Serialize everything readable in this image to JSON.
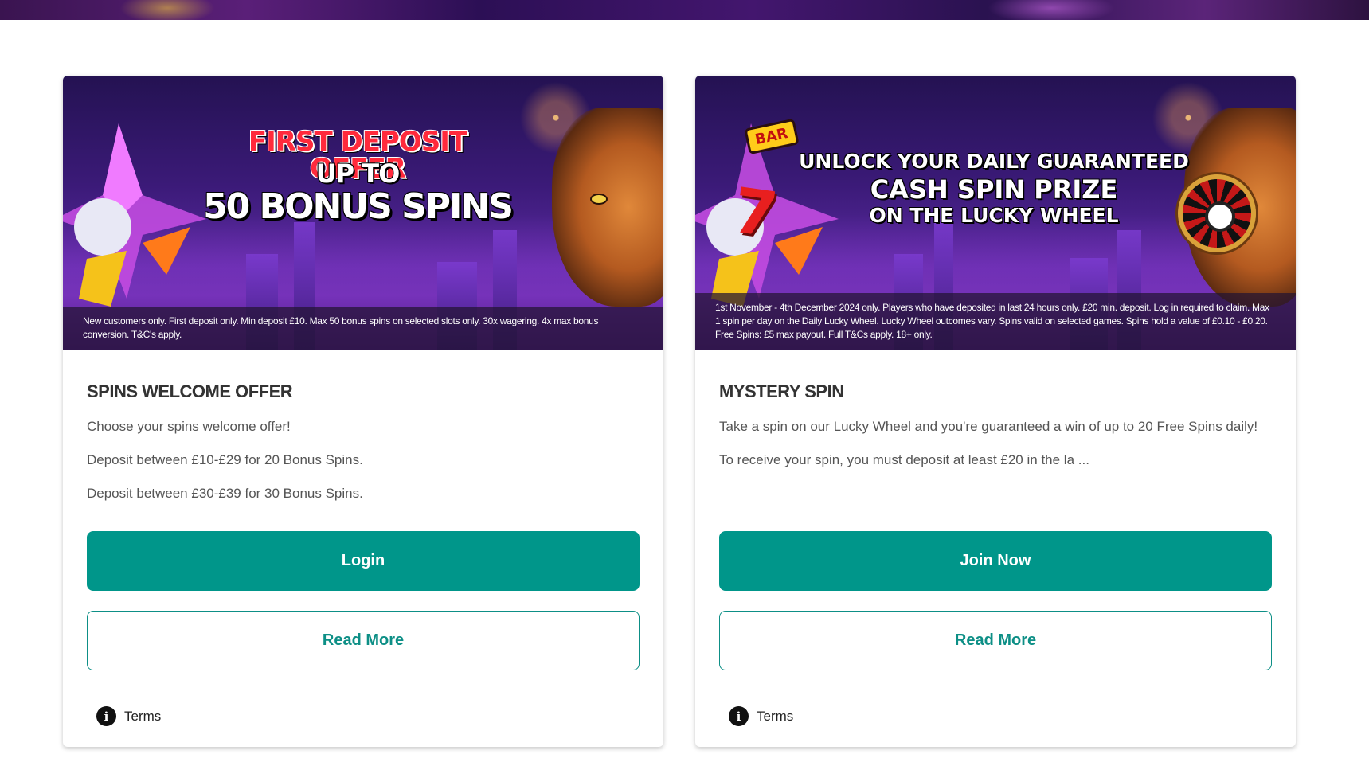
{
  "cards": [
    {
      "hero": {
        "line1": "FIRST DEPOSIT OFFER",
        "line2": "UP TO",
        "line3": "50 BONUS SPINS",
        "caption": "New customers only. First deposit only. Min deposit £10. Max 50 bonus spins on selected slots only. 30x wagering. 4x max bonus conversion. T&C's apply."
      },
      "title": "SPINS WELCOME OFFER",
      "paragraphs": [
        "Choose your spins welcome offer!",
        "Deposit between £10-£29 for 20 Bonus Spins.",
        "Deposit between £30-£39 for 30 Bonus Spins."
      ],
      "primary_button": "Login",
      "secondary_button": "Read More",
      "terms_label": "Terms"
    },
    {
      "hero": {
        "badge": "BAR",
        "seven": "7",
        "line1": "UNLOCK YOUR DAILY GUARANTEED",
        "line2": "CASH SPIN PRIZE",
        "line3": "ON THE LUCKY WHEEL",
        "caption": "1st November - 4th December 2024 only. Players who have deposited in last 24 hours only. £20 min. deposit. Log in required to claim. Max 1 spin per day on the Daily Lucky Wheel. Lucky Wheel outcomes vary. Spins valid on selected games. Spins hold a value of £0.10 - £0.20. Free Spins: £5 max payout. Full T&Cs apply. 18+ only."
      },
      "title": "MYSTERY SPIN",
      "paragraphs": [
        "Take a spin on our Lucky Wheel and you're guaranteed a win of up to 20 Free Spins daily!",
        "To receive your spin, you must deposit at least £20 in the la ..."
      ],
      "primary_button": "Join Now",
      "secondary_button": "Read More",
      "terms_label": "Terms"
    }
  ],
  "colors": {
    "primary": "#00968a",
    "primary_text": "#ffffff",
    "outline": "#0d8f86"
  },
  "icons": {
    "terms": "info-icon"
  }
}
